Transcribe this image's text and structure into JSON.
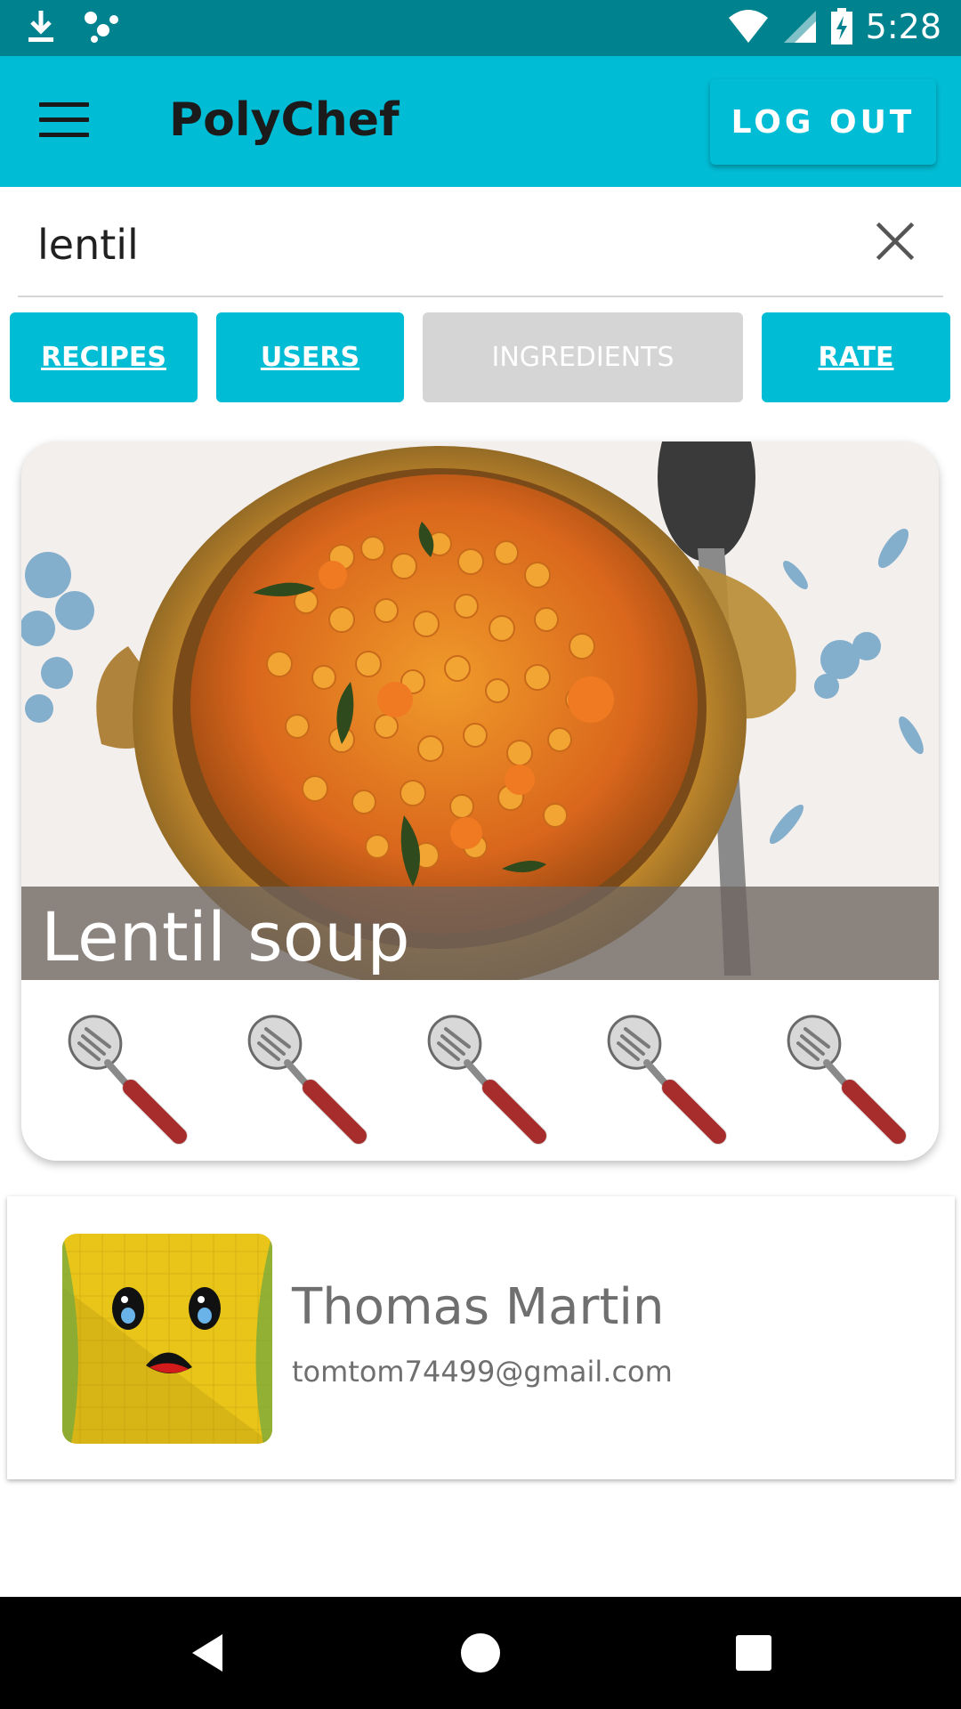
{
  "status_bar": {
    "time": "5:28",
    "icons": [
      "download-icon",
      "assistant-dots-icon",
      "wifi-icon",
      "cell-signal-icon",
      "battery-charging-icon"
    ]
  },
  "app_bar": {
    "title": "PolyChef",
    "logout_label": "LOG OUT",
    "menu_icon": "hamburger-menu-icon"
  },
  "search": {
    "value": "lentil",
    "clear_icon": "close-icon"
  },
  "filters": [
    {
      "label": "RECIPES",
      "state": "active"
    },
    {
      "label": "USERS",
      "state": "active"
    },
    {
      "label": "INGREDIENTS",
      "state": "disabled"
    },
    {
      "label": "RATE",
      "state": "active"
    }
  ],
  "recipe": {
    "title": "Lentil soup",
    "image": "lentil-soup-photo",
    "rating": 5,
    "rating_max": 5,
    "rating_icon": "spatula-icon"
  },
  "user": {
    "name": "Thomas Martin",
    "email": "tomtom74499@gmail.com",
    "avatar": "yellow-character-avatar"
  },
  "nav_bar": {
    "icons": [
      "back-icon",
      "home-icon",
      "recents-icon"
    ]
  },
  "colors": {
    "status_bar": "#00838f",
    "app_bar": "#00bcd4",
    "button_active": "#00bcd4",
    "button_inactive": "#d5d5d5",
    "spatula_handle": "#c0302e"
  }
}
